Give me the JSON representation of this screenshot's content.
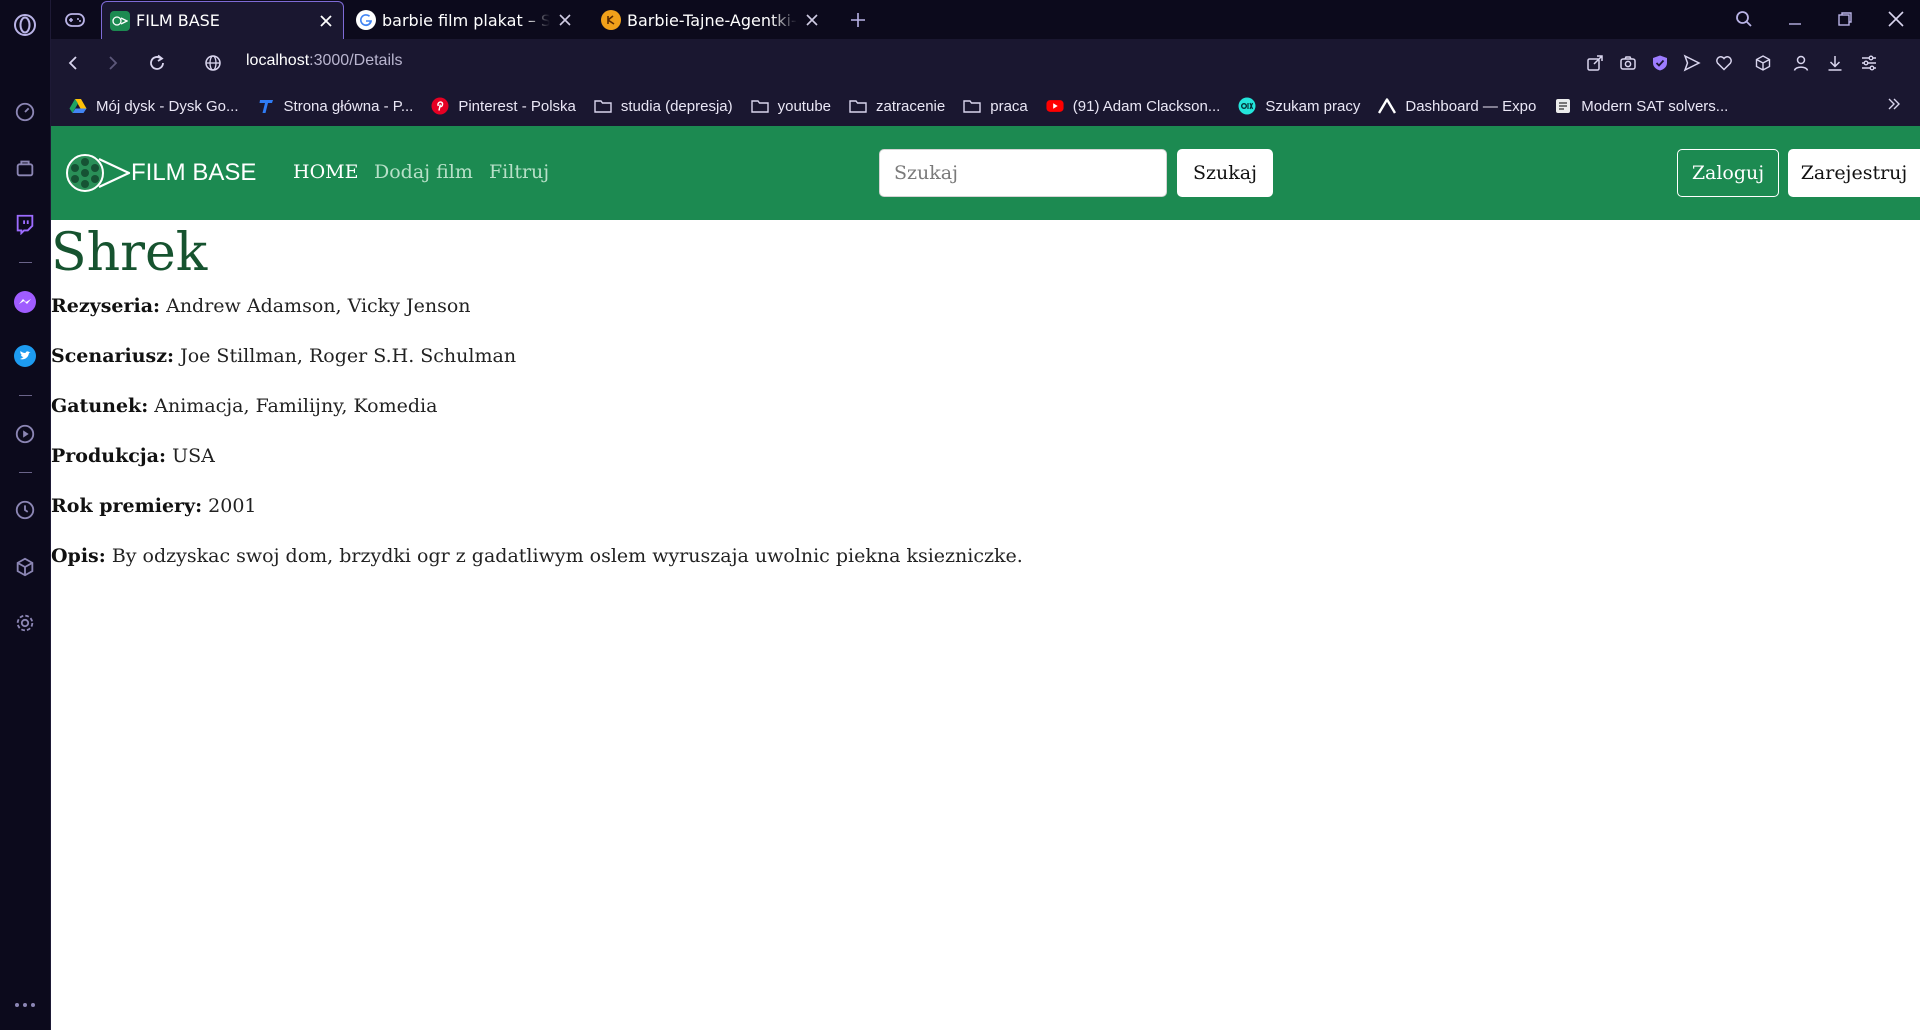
{
  "browser": {
    "tabs": [
      {
        "title": "FILM BASE",
        "active": true
      },
      {
        "title": "barbie film plakat – Szukaj w Google",
        "active": false
      },
      {
        "title": "Barbie-Tajne-Agentki-Plakat",
        "active": false
      }
    ],
    "address": {
      "host": "localhost",
      "path": ":3000/Details"
    },
    "bookmarks": [
      {
        "label": "Mój dysk - Dysk Go...",
        "icon": "google-drive-icon"
      },
      {
        "label": "Strona główna - P...",
        "icon": "t-logo-icon"
      },
      {
        "label": "Pinterest - Polska",
        "icon": "pinterest-icon"
      },
      {
        "label": "studia (depresja)",
        "icon": "folder-icon"
      },
      {
        "label": "youtube",
        "icon": "folder-icon"
      },
      {
        "label": "zatracenie",
        "icon": "folder-icon"
      },
      {
        "label": "praca",
        "icon": "folder-icon"
      },
      {
        "label": "(91) Adam Clackson...",
        "icon": "youtube-icon"
      },
      {
        "label": "Szukam pracy",
        "icon": "olx-icon"
      },
      {
        "label": "Dashboard — Expo",
        "icon": "expo-icon"
      },
      {
        "label": "Modern SAT solvers...",
        "icon": "document-icon"
      }
    ],
    "colors": {
      "chrome_dark": "#0c0a1c",
      "chrome_mid": "#1a1730",
      "accent": "#7e6bd6"
    }
  },
  "site": {
    "brand": "FILM BASE",
    "nav": {
      "home": "HOME",
      "add": "Dodaj film",
      "filter": "Filtruj"
    },
    "search": {
      "placeholder": "Szukaj",
      "value": "",
      "button": "Szukaj"
    },
    "auth": {
      "login": "Zaloguj",
      "register": "Zarejestruj"
    },
    "colors": {
      "navbar": "#1c8a51",
      "title": "#16532f"
    }
  },
  "movie": {
    "title": "Shrek",
    "fields": [
      {
        "label": "Rezyseria:",
        "value": "Andrew Adamson, Vicky Jenson"
      },
      {
        "label": "Scenariusz:",
        "value": "Joe Stillman, Roger S.H. Schulman"
      },
      {
        "label": "Gatunek:",
        "value": "Animacja, Familijny, Komedia"
      },
      {
        "label": "Produkcja:",
        "value": "USA"
      },
      {
        "label": "Rok premiery:",
        "value": "2001"
      },
      {
        "label": "Opis:",
        "value": "By odzyskac swoj dom, brzydki ogr z gadatliwym oslem wyruszaja uwolnic piekna ksiezniczke."
      }
    ]
  }
}
